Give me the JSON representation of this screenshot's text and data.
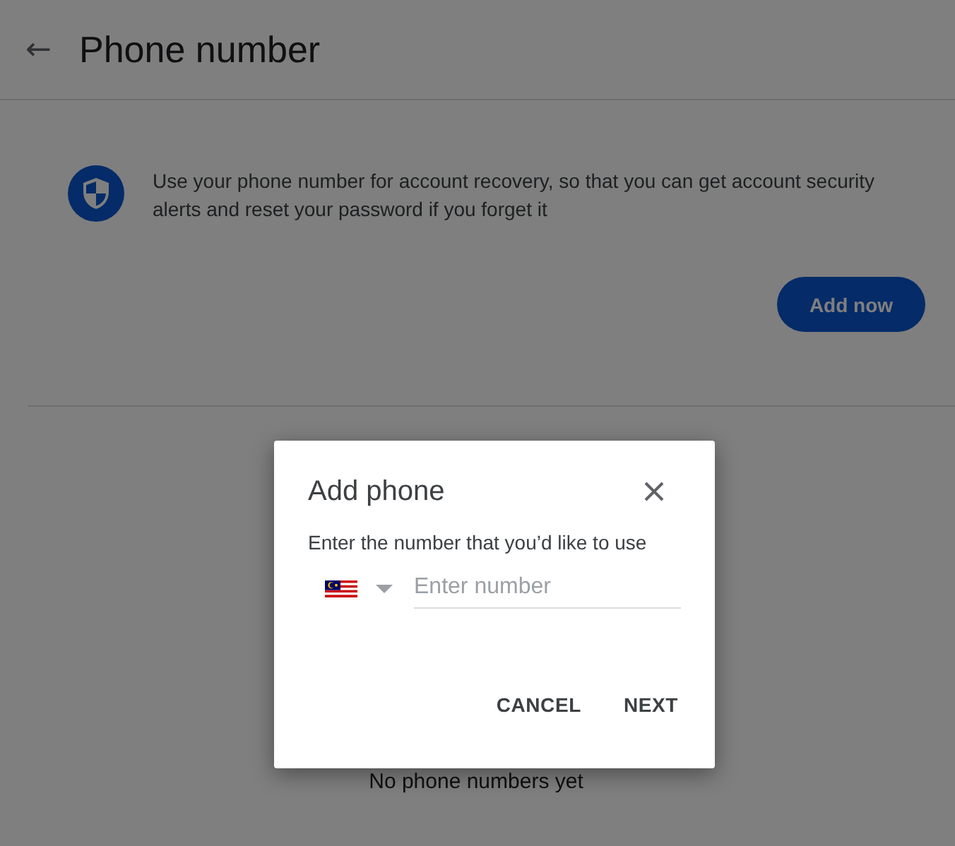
{
  "header": {
    "back_icon": "←",
    "title": "Phone number"
  },
  "info": {
    "text": "Use your phone number for account recovery, so that you can get account security alerts and reset your password if you forget it"
  },
  "add_button": {
    "label": "Add now"
  },
  "empty_message": "No phone numbers yet",
  "dialog": {
    "title": "Add phone",
    "subtitle": "Enter the number that you’d like to use",
    "phone_field": {
      "placeholder": "Enter number"
    },
    "buttons": [
      "CANCEL",
      "NEXT"
    ]
  }
}
